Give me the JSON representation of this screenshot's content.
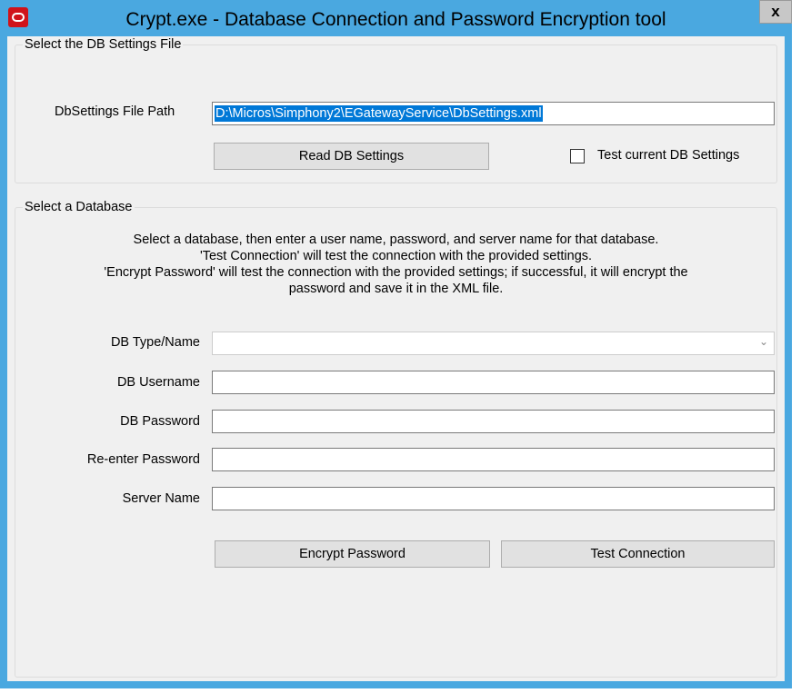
{
  "window": {
    "title": "Crypt.exe - Database Connection and Password Encryption tool",
    "close_label": "x"
  },
  "settings_group": {
    "legend": "Select the DB Settings File",
    "path_label": "DbSettings File Path",
    "path_value": "D:\\Micros\\Simphony2\\EGatewayService\\DbSettings.xml",
    "read_button": "Read DB Settings",
    "test_checkbox_label": "Test current DB Settings",
    "test_checked": false
  },
  "database_group": {
    "legend": "Select a Database",
    "description": [
      "Select a database, then enter a user name, password, and server name for that database.",
      "'Test Connection' will test the connection with the provided settings.",
      "'Encrypt Password' will test the connection with the provided settings; if successful, it will encrypt the",
      "password and save it in the XML file."
    ],
    "db_type_label": "DB Type/Name",
    "db_type_value": "",
    "username_label": "DB Username",
    "username_value": "",
    "password_label": "DB Password",
    "password_value": "",
    "reenter_label": "Re-enter Password",
    "reenter_value": "",
    "server_label": "Server Name",
    "server_value": "",
    "encrypt_button": "Encrypt Password",
    "test_button": "Test Connection"
  },
  "colors": {
    "titlebar": "#4aa8e0",
    "selection": "#0078d7",
    "app_icon": "#d0131a"
  },
  "icons": {
    "app": "oracle-icon",
    "dropdown": "chevron-down-icon"
  }
}
